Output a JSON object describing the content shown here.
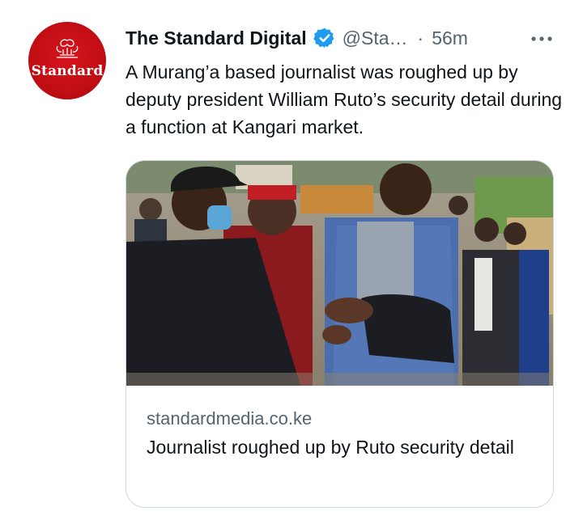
{
  "tweet": {
    "author": {
      "display_name": "The Standard Digital",
      "handle": "@Sta…",
      "avatar_text": "Standard",
      "verified": true
    },
    "separator": "·",
    "time": "56m",
    "text": "A Murang’a based journalist was roughed up by deputy president William Ruto’s security detail during a function at Kangari market.",
    "card": {
      "domain": "standardmedia.co.ke",
      "title": "Journalist roughed up by Ruto security detail",
      "image_icon": "news-photo"
    }
  },
  "colors": {
    "brand_red": "#c10e14",
    "verified_blue": "#1d9bf0",
    "secondary_text": "#536471",
    "border": "#cfd9de"
  }
}
